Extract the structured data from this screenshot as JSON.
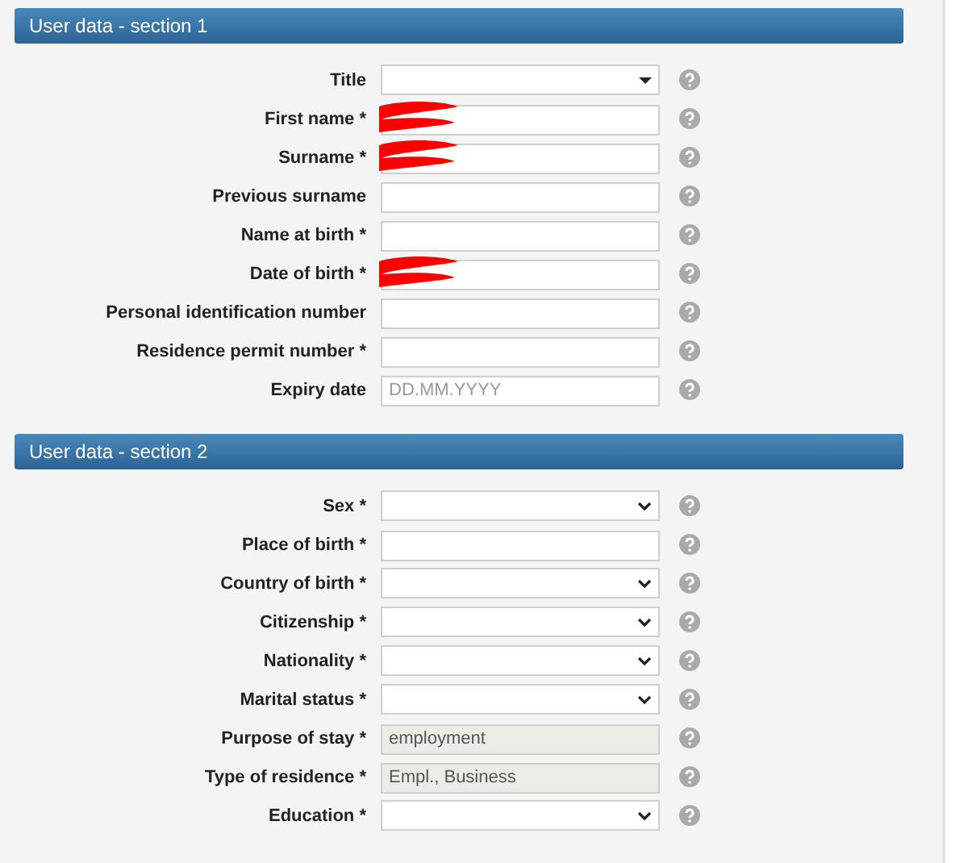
{
  "sections": [
    {
      "title": "User data - section 1",
      "fields": [
        {
          "label": "Title",
          "kind": "combo",
          "redacted": false
        },
        {
          "label": "First name *",
          "kind": "text",
          "redacted": true
        },
        {
          "label": "Surname *",
          "kind": "text",
          "redacted": true
        },
        {
          "label": "Previous surname",
          "kind": "text",
          "redacted": false
        },
        {
          "label": "Name at birth *",
          "kind": "text",
          "redacted": false
        },
        {
          "label": "Date of birth *",
          "kind": "text",
          "redacted": true
        },
        {
          "label": "Personal identification number",
          "kind": "text",
          "redacted": false
        },
        {
          "label": "Residence permit number *",
          "kind": "text",
          "redacted": false
        },
        {
          "label": "Expiry date",
          "kind": "text",
          "placeholder": "DD.MM.YYYY",
          "redacted": false
        }
      ]
    },
    {
      "title": "User data - section 2",
      "fields": [
        {
          "label": "Sex *",
          "kind": "select",
          "redacted": false
        },
        {
          "label": "Place of birth *",
          "kind": "text",
          "redacted": false
        },
        {
          "label": "Country of birth *",
          "kind": "select",
          "redacted": false
        },
        {
          "label": "Citizenship *",
          "kind": "select",
          "redacted": false
        },
        {
          "label": "Nationality *",
          "kind": "select",
          "redacted": false
        },
        {
          "label": "Marital status *",
          "kind": "select",
          "redacted": false
        },
        {
          "label": "Purpose of stay *",
          "kind": "text",
          "value": "employment",
          "disabled": true,
          "redacted": false
        },
        {
          "label": "Type of residence *",
          "kind": "text",
          "value": "Empl., Business",
          "disabled": true,
          "redacted": false
        },
        {
          "label": "Education *",
          "kind": "select",
          "redacted": false
        }
      ]
    }
  ]
}
